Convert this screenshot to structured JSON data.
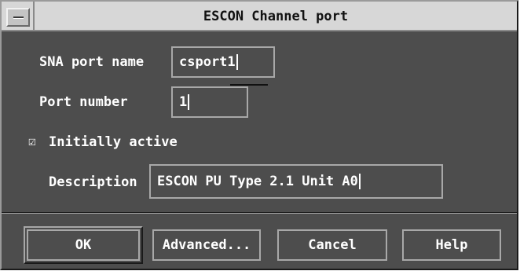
{
  "window": {
    "title": "ESCON Channel port"
  },
  "form": {
    "sna_port_name": {
      "label": "SNA port name",
      "value": "csport1"
    },
    "port_number": {
      "label": "Port number",
      "value": "1"
    },
    "initially_active": {
      "label": "Initially active",
      "checked": true,
      "mark": "☑"
    },
    "description": {
      "label": "Description",
      "value": "ESCON PU Type 2.1 Unit A0"
    }
  },
  "buttons": {
    "ok": "OK",
    "advanced": "Advanced...",
    "cancel": "Cancel",
    "help": "Help"
  },
  "icons": {
    "window_menu": "window-menu-icon",
    "checkbox": "checkbox-icon"
  },
  "colors": {
    "dialog_bg": "#4d4d4d",
    "titlebar_bg": "#d7d7d7",
    "bevel_light": "#a8a8a8",
    "text": "#ffffff"
  }
}
